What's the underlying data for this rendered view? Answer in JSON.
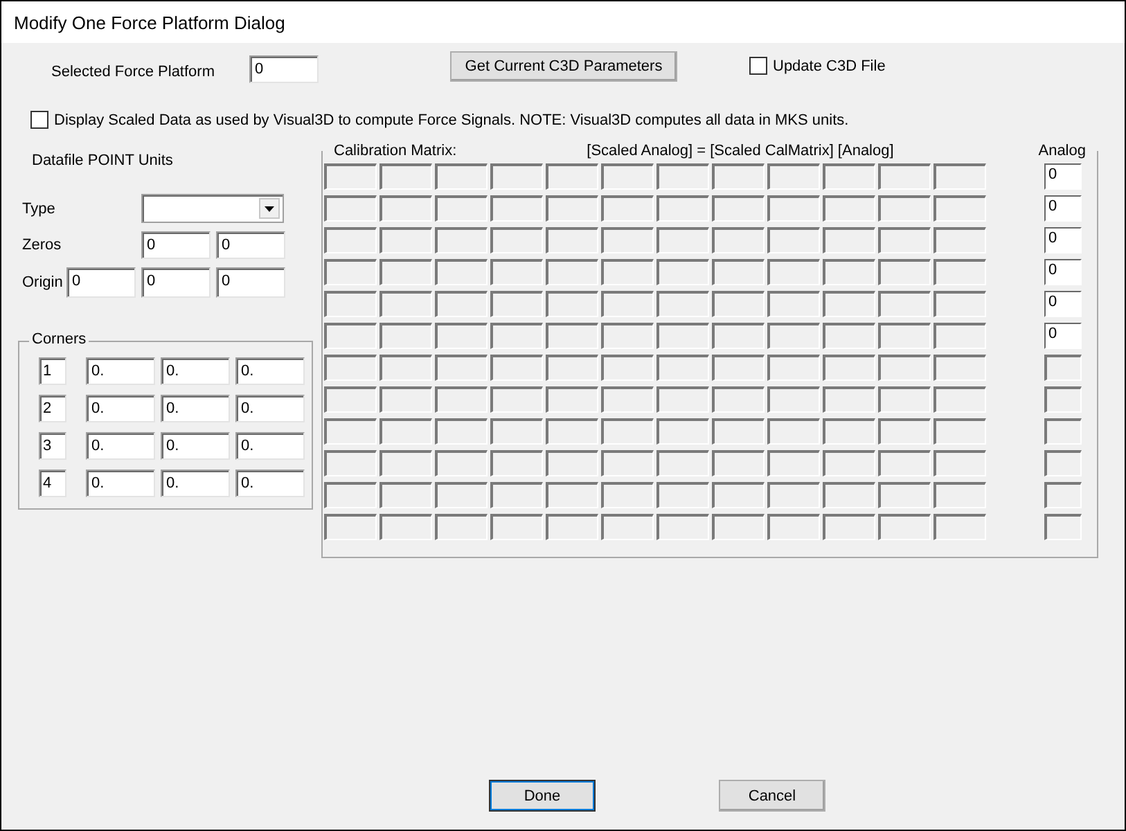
{
  "window": {
    "title": "Modify One Force Platform Dialog"
  },
  "selected_force_platform": {
    "label": "Selected Force Platform",
    "value": "0"
  },
  "get_parameters_button": {
    "label": "Get Current C3D Parameters"
  },
  "update_c3d_file": {
    "label": "Update C3D File",
    "checked": false
  },
  "display_scaled": {
    "label": "Display Scaled Data as used by Visual3D to compute Force Signals. NOTE: Visual3D computes all data in MKS units.",
    "checked": false
  },
  "point_units": {
    "label": "Datafile POINT Units"
  },
  "type": {
    "label": "Type"
  },
  "zeros": {
    "label": "Zeros",
    "values": [
      "0",
      "0"
    ]
  },
  "origin": {
    "label": "Origin",
    "values": [
      "0",
      "0",
      "0"
    ]
  },
  "corners": {
    "title": "Corners",
    "rows": [
      {
        "number": "1",
        "values": [
          "0.",
          "0.",
          "0."
        ]
      },
      {
        "number": "2",
        "values": [
          "0.",
          "0.",
          "0."
        ]
      },
      {
        "number": "3",
        "values": [
          "0.",
          "0.",
          "0."
        ]
      },
      {
        "number": "4",
        "values": [
          "0.",
          "0.",
          "0."
        ]
      }
    ]
  },
  "calibration_matrix": {
    "title": "Calibration Matrix:",
    "equation": "[Scaled Analog] = [Scaled CalMatrix] [Analog]",
    "rows": [
      [
        {
          "disabled": true
        },
        {
          "disabled": true
        },
        {
          "disabled": true
        },
        {
          "disabled": true
        },
        {
          "disabled": true
        },
        {
          "disabled": true
        },
        {
          "disabled": true
        },
        {
          "disabled": true
        },
        {
          "disabled": true
        },
        {
          "disabled": true
        },
        {
          "disabled": true
        },
        {
          "disabled": true
        }
      ],
      [
        {
          "disabled": true
        },
        {
          "disabled": true
        },
        {
          "disabled": true
        },
        {
          "disabled": true
        },
        {
          "disabled": true
        },
        {
          "disabled": true
        },
        {
          "disabled": true
        },
        {
          "disabled": true
        },
        {
          "disabled": true
        },
        {
          "disabled": true
        },
        {
          "disabled": true
        },
        {
          "disabled": true
        }
      ],
      [
        {
          "disabled": true
        },
        {
          "disabled": true
        },
        {
          "disabled": true
        },
        {
          "disabled": true
        },
        {
          "disabled": true
        },
        {
          "disabled": true
        },
        {
          "disabled": true
        },
        {
          "disabled": true
        },
        {
          "disabled": true
        },
        {
          "disabled": true
        },
        {
          "disabled": true
        },
        {
          "disabled": true
        }
      ],
      [
        {
          "disabled": true
        },
        {
          "disabled": true
        },
        {
          "disabled": true
        },
        {
          "disabled": true
        },
        {
          "disabled": true
        },
        {
          "disabled": true
        },
        {
          "disabled": true
        },
        {
          "disabled": true
        },
        {
          "disabled": true
        },
        {
          "disabled": true
        },
        {
          "disabled": true
        },
        {
          "disabled": true
        }
      ],
      [
        {
          "disabled": true
        },
        {
          "disabled": true
        },
        {
          "disabled": true
        },
        {
          "disabled": true
        },
        {
          "disabled": true
        },
        {
          "disabled": true
        },
        {
          "disabled": true
        },
        {
          "disabled": true
        },
        {
          "disabled": true
        },
        {
          "disabled": true
        },
        {
          "disabled": true
        },
        {
          "disabled": true
        }
      ],
      [
        {
          "disabled": true
        },
        {
          "disabled": true
        },
        {
          "disabled": true
        },
        {
          "disabled": true
        },
        {
          "disabled": true
        },
        {
          "disabled": true
        },
        {
          "disabled": true
        },
        {
          "disabled": true
        },
        {
          "disabled": true
        },
        {
          "disabled": true
        },
        {
          "disabled": true
        },
        {
          "disabled": true
        }
      ],
      [
        {
          "disabled": true
        },
        {
          "disabled": true
        },
        {
          "disabled": true
        },
        {
          "disabled": true
        },
        {
          "disabled": true
        },
        {
          "disabled": true
        },
        {
          "disabled": true
        },
        {
          "disabled": true
        },
        {
          "disabled": true
        },
        {
          "disabled": true
        },
        {
          "disabled": true
        },
        {
          "disabled": true
        }
      ],
      [
        {
          "disabled": true
        },
        {
          "disabled": true
        },
        {
          "disabled": true
        },
        {
          "disabled": true
        },
        {
          "disabled": true
        },
        {
          "disabled": true
        },
        {
          "disabled": true
        },
        {
          "disabled": true
        },
        {
          "disabled": true
        },
        {
          "disabled": true
        },
        {
          "disabled": true
        },
        {
          "disabled": true
        }
      ],
      [
        {
          "disabled": true
        },
        {
          "disabled": true
        },
        {
          "disabled": true
        },
        {
          "disabled": true
        },
        {
          "disabled": true
        },
        {
          "disabled": true
        },
        {
          "disabled": true
        },
        {
          "disabled": true
        },
        {
          "disabled": true
        },
        {
          "disabled": true
        },
        {
          "disabled": true
        },
        {
          "disabled": true
        }
      ],
      [
        {
          "disabled": true
        },
        {
          "disabled": true
        },
        {
          "disabled": true
        },
        {
          "disabled": true
        },
        {
          "disabled": true
        },
        {
          "disabled": true
        },
        {
          "disabled": true
        },
        {
          "disabled": true
        },
        {
          "disabled": true
        },
        {
          "disabled": true
        },
        {
          "disabled": true
        },
        {
          "disabled": true
        }
      ],
      [
        {
          "disabled": true
        },
        {
          "disabled": true
        },
        {
          "disabled": true
        },
        {
          "disabled": true
        },
        {
          "disabled": true
        },
        {
          "disabled": true
        },
        {
          "disabled": true
        },
        {
          "disabled": true
        },
        {
          "disabled": true
        },
        {
          "disabled": true
        },
        {
          "disabled": true
        },
        {
          "disabled": true
        }
      ],
      [
        {
          "disabled": true
        },
        {
          "disabled": true
        },
        {
          "disabled": true
        },
        {
          "disabled": true
        },
        {
          "disabled": true
        },
        {
          "disabled": true
        },
        {
          "disabled": true
        },
        {
          "disabled": true
        },
        {
          "disabled": true
        },
        {
          "disabled": true
        },
        {
          "disabled": true
        },
        {
          "disabled": true
        }
      ]
    ]
  },
  "analog": {
    "title": "Analog",
    "fields": [
      {
        "value": "0",
        "disabled": false
      },
      {
        "value": "0",
        "disabled": false
      },
      {
        "value": "0",
        "disabled": false
      },
      {
        "value": "0",
        "disabled": false
      },
      {
        "value": "0",
        "disabled": false
      },
      {
        "value": "0",
        "disabled": false
      },
      {
        "disabled": true
      },
      {
        "disabled": true
      },
      {
        "disabled": true
      },
      {
        "disabled": true
      },
      {
        "disabled": true
      },
      {
        "disabled": true
      }
    ]
  },
  "buttons": [
    {
      "label": "Done",
      "default": true
    },
    {
      "label": "Cancel",
      "default": false
    }
  ]
}
